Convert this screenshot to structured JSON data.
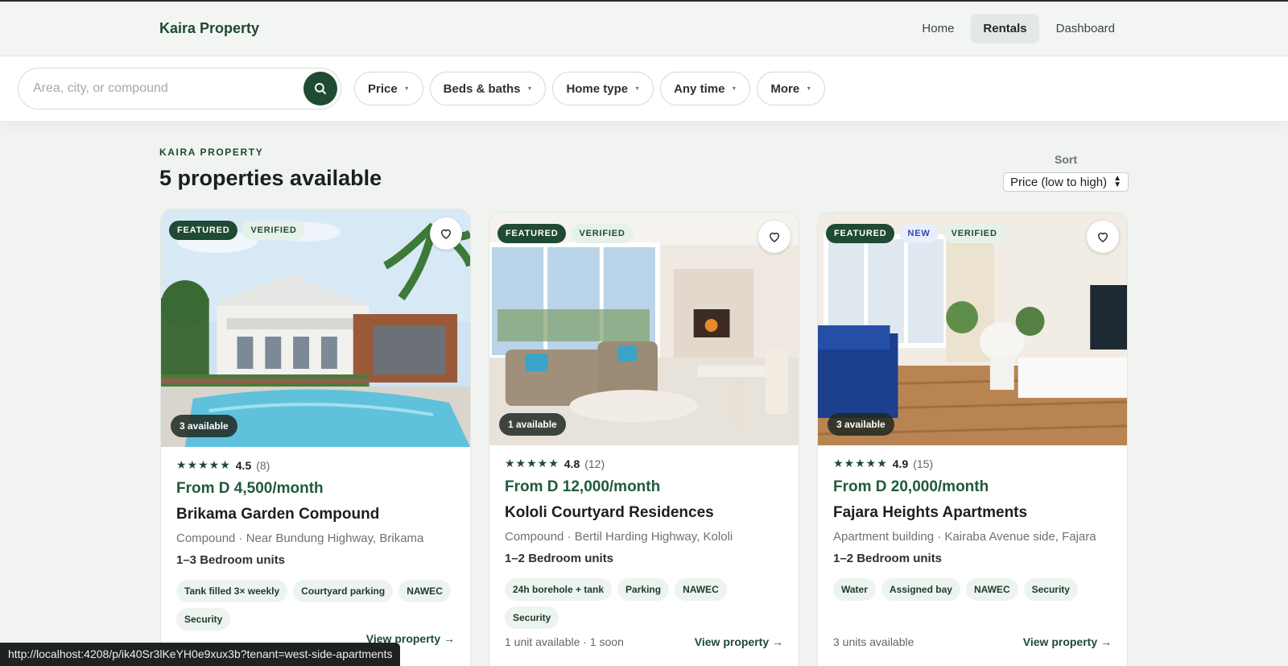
{
  "nav": {
    "brand": "Kaira Property",
    "links": [
      {
        "label": "Home",
        "active": false
      },
      {
        "label": "Rentals",
        "active": true
      },
      {
        "label": "Dashboard",
        "active": false
      }
    ]
  },
  "search": {
    "placeholder": "Area, city, or compound",
    "icon": "search-icon"
  },
  "filters": [
    {
      "label": "Price"
    },
    {
      "label": "Beds & baths"
    },
    {
      "label": "Home type"
    },
    {
      "label": "Any time"
    },
    {
      "label": "More"
    }
  ],
  "listing_header": {
    "eyebrow": "KAIRA PROPERTY",
    "count_text": "5 properties available"
  },
  "sort": {
    "label": "Sort",
    "selected": "Price (low to high)"
  },
  "cards": [
    {
      "badges": [
        "FEATURED",
        "VERIFIED"
      ],
      "availability_badge": "3 available",
      "stars": "★★★★★",
      "rating": "4.5",
      "reviews": "(8)",
      "price": "From D 4,500/month",
      "name": "Brikama Garden Compound",
      "location": "Compound · Near Bundung Highway, Brikama",
      "units": "1–3 Bedroom units",
      "tags": [
        "Tank filled 3× weekly",
        "Courtyard parking",
        "NAWEC",
        "Security"
      ],
      "units_available": "",
      "view_label": "View property →"
    },
    {
      "badges": [
        "FEATURED",
        "VERIFIED"
      ],
      "availability_badge": "1 available",
      "stars": "★★★★★",
      "rating": "4.8",
      "reviews": "(12)",
      "price": "From D 12,000/month",
      "name": "Kololi Courtyard Residences",
      "location": "Compound · Bertil Harding Highway, Kololi",
      "units": "1–2 Bedroom units",
      "tags": [
        "24h borehole + tank",
        "Parking",
        "NAWEC",
        "Security"
      ],
      "units_available": "1 unit available · 1 soon",
      "view_label": "View property →"
    },
    {
      "badges": [
        "FEATURED",
        "NEW",
        "VERIFIED"
      ],
      "availability_badge": "3 available",
      "stars": "★★★★★",
      "rating": "4.9",
      "reviews": "(15)",
      "price": "From D 20,000/month",
      "name": "Fajara Heights Apartments",
      "location": "Apartment building · Kairaba Avenue side, Fajara",
      "units": "1–2 Bedroom units",
      "tags": [
        "Water",
        "Assigned bay",
        "NAWEC",
        "Security"
      ],
      "units_available": "3 units available",
      "view_label": "View property →"
    }
  ],
  "status_url": "http://localhost:4208/p/ik40Sr3lKeYH0e9xux3b?tenant=west-side-apartments",
  "colors": {
    "brand_green": "#1f4a33",
    "price_green": "#1f5a3c",
    "tag_bg": "#edf4ef",
    "page_bg": "#f1f3f1"
  }
}
